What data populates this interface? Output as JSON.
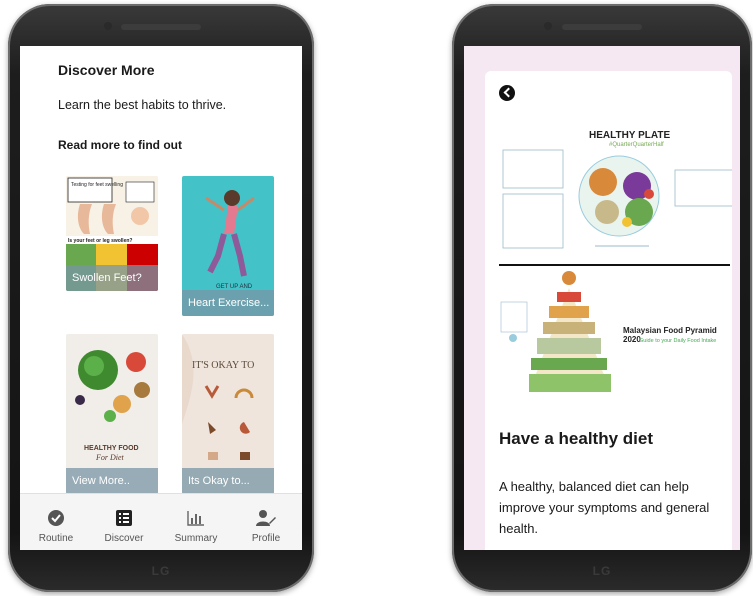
{
  "left_phone": {
    "brand": "LG",
    "discover": {
      "title": "Discover More",
      "subtitle": "Learn the best habits to thrive.",
      "section_label": "Read more to find out",
      "cards": [
        {
          "caption": "Swollen Feet?",
          "image_text": "Testing for feet swelling",
          "image_text_2": "Is your feet or leg swollen?"
        },
        {
          "caption": "Heart Exercise...",
          "image_text": "GET UP AND"
        },
        {
          "caption": "View More..",
          "image_text": "HEALTHY FOOD",
          "image_text_2": "For Diet"
        },
        {
          "caption": "Its Okay to...",
          "image_text": "IT'S OKAY TO"
        }
      ]
    },
    "nav": [
      {
        "label": "Routine",
        "icon": "check-circle-icon"
      },
      {
        "label": "Discover",
        "icon": "list-icon"
      },
      {
        "label": "Summary",
        "icon": "bar-chart-icon"
      },
      {
        "label": "Profile",
        "icon": "user-edit-icon"
      }
    ]
  },
  "right_phone": {
    "brand": "LG",
    "article": {
      "plate_image_title": "HEALTHY PLATE",
      "plate_image_subtitle": "#QuarterQuarterHalf",
      "pyramid_image_title": "Malaysian Food Pyramid 2020",
      "pyramid_image_subtitle": "Guide to your Daily Food Intake",
      "heading": "Have a healthy diet",
      "body": "A healthy, balanced diet can help improve your symptoms and general health."
    }
  },
  "colors": {
    "card_caption_bg": "#7896a5",
    "heart_card_bg": "#43c3c7",
    "right_screen_bg": "#f6e8f3",
    "nav_bg": "#f5f5f5"
  }
}
